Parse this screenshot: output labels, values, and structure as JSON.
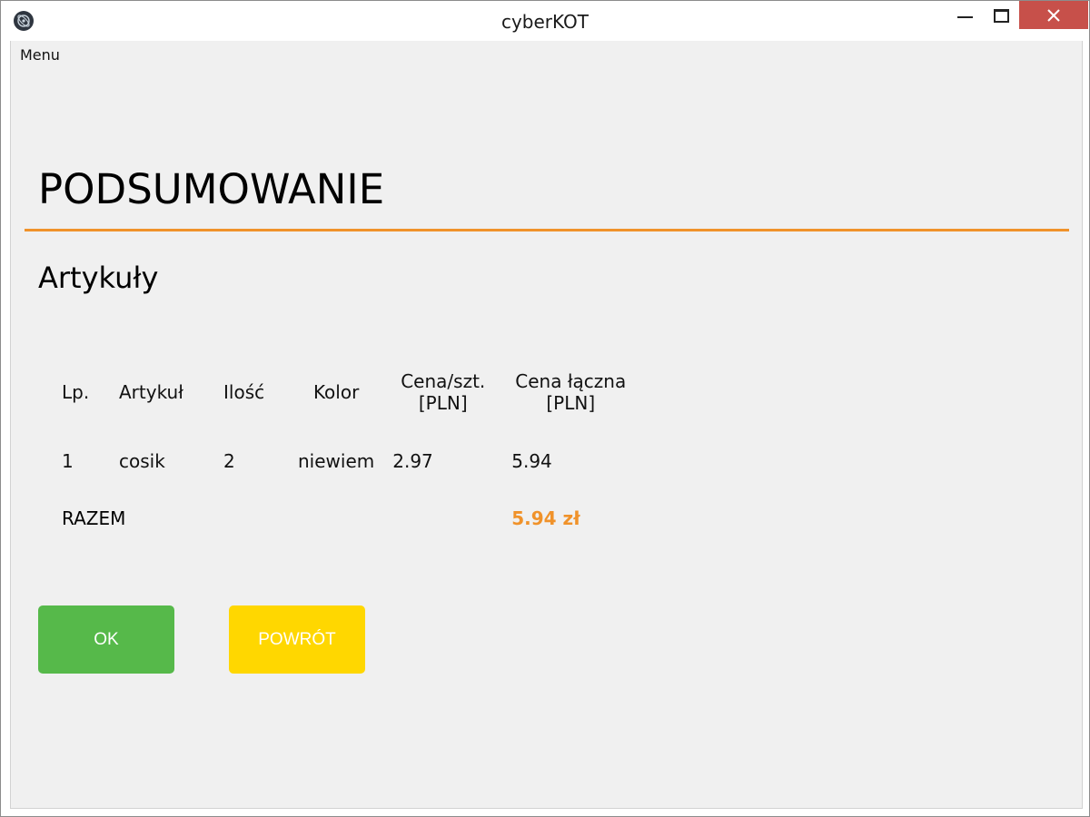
{
  "window": {
    "title": "cyberKOT"
  },
  "menu": {
    "label": "Menu"
  },
  "page": {
    "title": "PODSUMOWANIE",
    "section_title": "Artykuły"
  },
  "colors": {
    "accent": "#f0922a",
    "ok_button": "#56b94a",
    "back_button": "#ffd700",
    "close_button": "#c7504a"
  },
  "table": {
    "headers": {
      "lp": "Lp.",
      "article": "Artykuł",
      "quantity": "Ilość",
      "color": "Kolor",
      "unit_price_line1": "Cena/szt.",
      "unit_price_line2": "[PLN]",
      "total_price_line1": "Cena łączna",
      "total_price_line2": "[PLN]"
    },
    "rows": [
      {
        "lp": "1",
        "article": "cosik",
        "quantity": "2",
        "color": "niewiem",
        "unit_price": "2.97",
        "total_price": "5.94"
      }
    ],
    "total": {
      "label": "RAZEM",
      "value": "5.94 zł"
    }
  },
  "buttons": {
    "ok": "OK",
    "back": "POWRÓT"
  },
  "icons": {
    "app": "app-logo-icon",
    "minimize": "minimize-icon",
    "maximize": "maximize-icon",
    "close": "close-icon"
  }
}
